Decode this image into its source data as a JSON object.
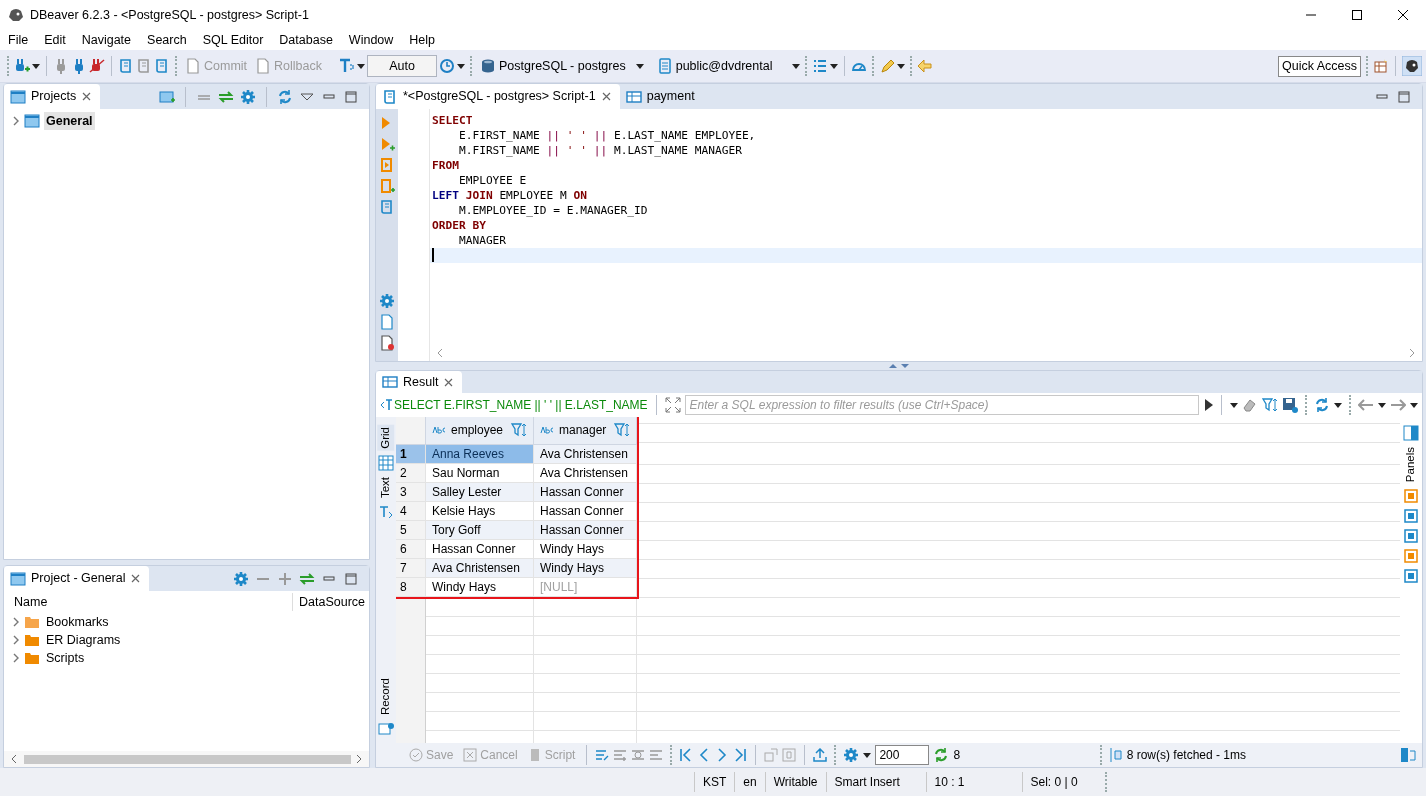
{
  "window": {
    "title": "DBeaver 6.2.3 - <PostgreSQL - postgres> Script-1"
  },
  "menu": [
    "File",
    "Edit",
    "Navigate",
    "Search",
    "SQL Editor",
    "Database",
    "Window",
    "Help"
  ],
  "toolbar": {
    "commit": "Commit",
    "rollback": "Rollback",
    "transaction_mode": "Auto",
    "connection": "PostgreSQL - postgres",
    "schema": "public@dvdrental",
    "quick_access": "Quick Access"
  },
  "projects_panel": {
    "title": "Projects",
    "items": [
      {
        "label": "General",
        "selected": true
      }
    ]
  },
  "project_general": {
    "title": "Project - General",
    "columns": [
      "Name",
      "DataSource"
    ],
    "items": [
      {
        "label": "Bookmarks",
        "kind": "bookmarks"
      },
      {
        "label": "ER Diagrams",
        "kind": "diagrams"
      },
      {
        "label": "Scripts",
        "kind": "scripts"
      }
    ]
  },
  "editor_tabs": [
    {
      "label": "*<PostgreSQL - postgres> Script-1",
      "selected": true,
      "kind": "script"
    },
    {
      "label": "payment",
      "selected": false,
      "kind": "table"
    }
  ],
  "sql_lines": [
    {
      "current": false,
      "tokens": [
        {
          "text": "SELECT",
          "kind": "keyword"
        }
      ]
    },
    {
      "current": false,
      "tokens": [
        {
          "text": "    E.FIRST_NAME ",
          "kind": "plain"
        },
        {
          "text": "||",
          "kind": "operator"
        },
        {
          "text": " ' ' ",
          "kind": "string"
        },
        {
          "text": "||",
          "kind": "operator"
        },
        {
          "text": " E.LAST_NAME EMPLOYEE,",
          "kind": "plain"
        }
      ]
    },
    {
      "current": false,
      "tokens": [
        {
          "text": "    M.FIRST_NAME ",
          "kind": "plain"
        },
        {
          "text": "||",
          "kind": "operator"
        },
        {
          "text": " ' ' ",
          "kind": "string"
        },
        {
          "text": "||",
          "kind": "operator"
        },
        {
          "text": " M.LAST_NAME MANAGER",
          "kind": "plain"
        }
      ]
    },
    {
      "current": false,
      "tokens": [
        {
          "text": "FROM",
          "kind": "keyword"
        }
      ]
    },
    {
      "current": false,
      "tokens": [
        {
          "text": "    EMPLOYEE E",
          "kind": "plain"
        }
      ]
    },
    {
      "current": false,
      "tokens": [
        {
          "text": "LEFT",
          "kind": "join"
        },
        {
          "text": " JOIN",
          "kind": "keyword"
        },
        {
          "text": " EMPLOYEE M ",
          "kind": "plain"
        },
        {
          "text": "ON",
          "kind": "keyword"
        }
      ]
    },
    {
      "current": false,
      "tokens": [
        {
          "text": "    M.EMPLOYEE_ID = E.MANAGER_ID",
          "kind": "plain"
        }
      ]
    },
    {
      "current": false,
      "tokens": [
        {
          "text": "ORDER BY",
          "kind": "keyword"
        }
      ]
    },
    {
      "current": false,
      "tokens": [
        {
          "text": "    MANAGER",
          "kind": "plain"
        }
      ]
    },
    {
      "current": true
    }
  ],
  "result": {
    "tab": "Result",
    "query": "SELECT E.FIRST_NAME || ' ' || E.LAST_NAME",
    "filter_placeholder": "Enter a SQL expression to filter results (use Ctrl+Space)",
    "view_tabs": [
      {
        "label": "Grid",
        "selected": true
      },
      {
        "label": "Text",
        "selected": false
      },
      {
        "label": "Record",
        "selected": false
      }
    ],
    "panels_label": "Panels",
    "highlighted": true,
    "columns": [
      "employee",
      "manager"
    ],
    "rows": [
      {
        "number": "1",
        "selected": true,
        "cells": [
          {
            "text": "Anna Reeves",
            "is_null": false
          },
          {
            "text": "Ava Christensen",
            "is_null": false
          }
        ]
      },
      {
        "number": "2",
        "selected": false,
        "cells": [
          {
            "text": "Sau Norman",
            "is_null": false
          },
          {
            "text": "Ava Christensen",
            "is_null": false
          }
        ]
      },
      {
        "number": "3",
        "selected": false,
        "cells": [
          {
            "text": "Salley Lester",
            "is_null": false
          },
          {
            "text": "Hassan Conner",
            "is_null": false
          }
        ]
      },
      {
        "number": "4",
        "selected": false,
        "cells": [
          {
            "text": "Kelsie Hays",
            "is_null": false
          },
          {
            "text": "Hassan Conner",
            "is_null": false
          }
        ]
      },
      {
        "number": "5",
        "selected": false,
        "cells": [
          {
            "text": "Tory Goff",
            "is_null": false
          },
          {
            "text": "Hassan Conner",
            "is_null": false
          }
        ]
      },
      {
        "number": "6",
        "selected": false,
        "cells": [
          {
            "text": "Hassan Conner",
            "is_null": false
          },
          {
            "text": "Windy Hays",
            "is_null": false
          }
        ]
      },
      {
        "number": "7",
        "selected": false,
        "cells": [
          {
            "text": "Ava Christensen",
            "is_null": false
          },
          {
            "text": "Windy Hays",
            "is_null": false
          }
        ]
      },
      {
        "number": "8",
        "selected": false,
        "cells": [
          {
            "text": "Windy Hays",
            "is_null": false
          },
          {
            "text": "[NULL]",
            "is_null": true
          }
        ]
      }
    ],
    "bottom": {
      "save": "Save",
      "cancel": "Cancel",
      "script": "Script",
      "fetch_size": "200",
      "row_count": "8",
      "status": "8 row(s) fetched - 1ms"
    }
  },
  "status_bar": [
    "KST",
    "en",
    "Writable",
    "Smart Insert",
    "10 : 1",
    "Sel: 0 | 0"
  ]
}
